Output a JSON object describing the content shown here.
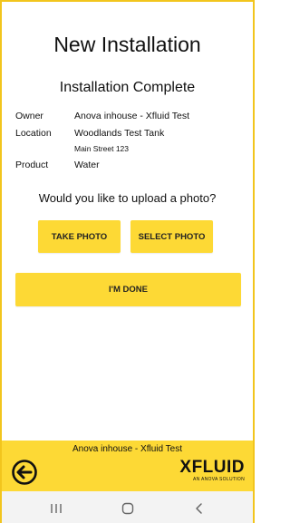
{
  "screen": {
    "title": "New Installation",
    "subtitle": "Installation Complete"
  },
  "details": {
    "owner_label": "Owner",
    "owner_value": "Anova inhouse - Xfluid Test",
    "location_label": "Location",
    "location_value": "Woodlands Test Tank",
    "location_address": "Main Street 123",
    "product_label": "Product",
    "product_value": "Water"
  },
  "photo": {
    "question": "Would you like to upload a photo?",
    "take_label": "TAKE PHOTO",
    "select_label": "SELECT PHOTO"
  },
  "actions": {
    "done_label": "I'M DONE"
  },
  "footer": {
    "account_text": "Anova inhouse - Xfluid Test",
    "logo_text": "XFLUID",
    "logo_tagline": "AN ANOVA SOLUTION"
  },
  "icons": {
    "back": "arrow-left-circle-icon",
    "nav_recents": "recents-icon",
    "nav_home": "home-icon",
    "nav_back": "chevron-left-icon"
  },
  "colors": {
    "accent": "#fdd935",
    "border": "#f2c51d",
    "text": "#111111",
    "nav_bg": "#f3f3f3"
  }
}
